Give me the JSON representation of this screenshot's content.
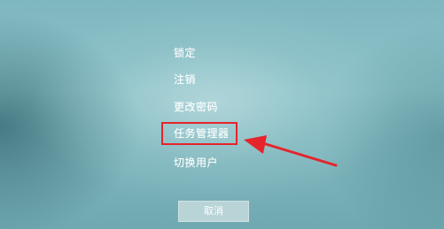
{
  "menu": {
    "items": [
      {
        "label": "锁定"
      },
      {
        "label": "注销"
      },
      {
        "label": "更改密码"
      },
      {
        "label": "任务管理器"
      },
      {
        "label": "切换用户"
      }
    ]
  },
  "cancel_button": {
    "label": "取消"
  },
  "annotation": {
    "highlight_color": "#e5242b",
    "arrow_color": "#e5242b",
    "highlighted_item": "任务管理器"
  }
}
